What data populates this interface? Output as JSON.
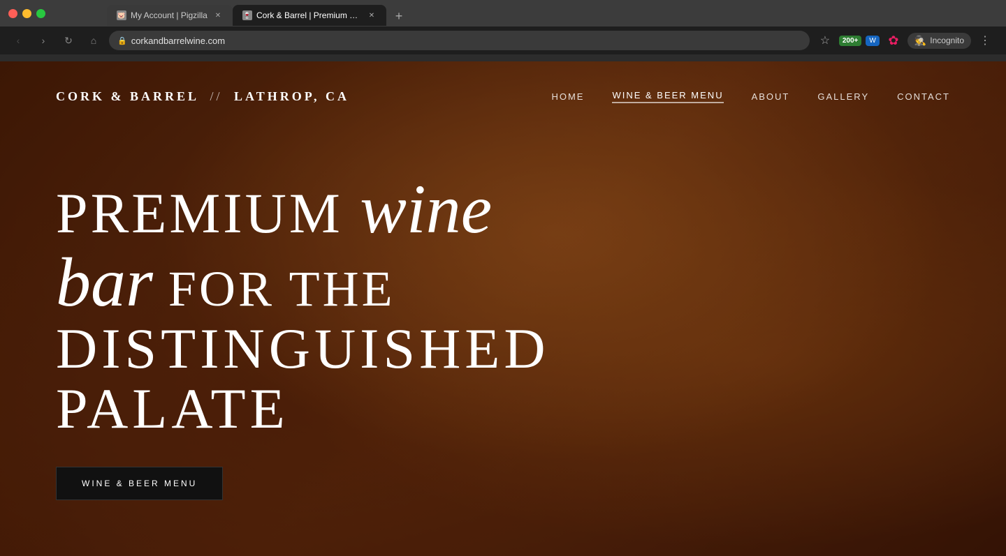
{
  "browser": {
    "tabs": [
      {
        "id": "tab-1",
        "title": "My Account | Pigzilla",
        "favicon_char": "🐷",
        "active": false,
        "url": ""
      },
      {
        "id": "tab-2",
        "title": "Cork & Barrel | Premium Wine B…",
        "favicon_char": "🍷",
        "active": true,
        "url": "corkandbarrelwine.com"
      }
    ],
    "new_tab_label": "+",
    "address": "corkandbarrelwine.com",
    "nav_back": "‹",
    "nav_forward": "›",
    "nav_refresh": "↻",
    "nav_home": "⌂",
    "star_icon": "☆",
    "ext1_label": "200+",
    "ext2_label": "W",
    "incognito_label": "Incognito",
    "more_icon": "⋮"
  },
  "website": {
    "logo_part1": "CORK & BARREL",
    "logo_slash": "//",
    "logo_part2": "LATHROP, CA",
    "nav": [
      {
        "id": "nav-home",
        "label": "HOME",
        "active": false
      },
      {
        "id": "nav-wine-beer",
        "label": "WINE & BEER MENU",
        "active": true
      },
      {
        "id": "nav-about",
        "label": "ABOUT",
        "active": false
      },
      {
        "id": "nav-gallery",
        "label": "GALLERY",
        "active": false
      },
      {
        "id": "nav-contact",
        "label": "CONTACT",
        "active": false
      }
    ],
    "hero": {
      "line1_plain": "PREMIUM",
      "line1_cursive": "wine",
      "line2_cursive": "bar",
      "line2_plain": " FOR THE",
      "line3": "DISTINGUISHED",
      "line4": "PALATE",
      "cta_label": "WINE & BEER MENU"
    }
  }
}
